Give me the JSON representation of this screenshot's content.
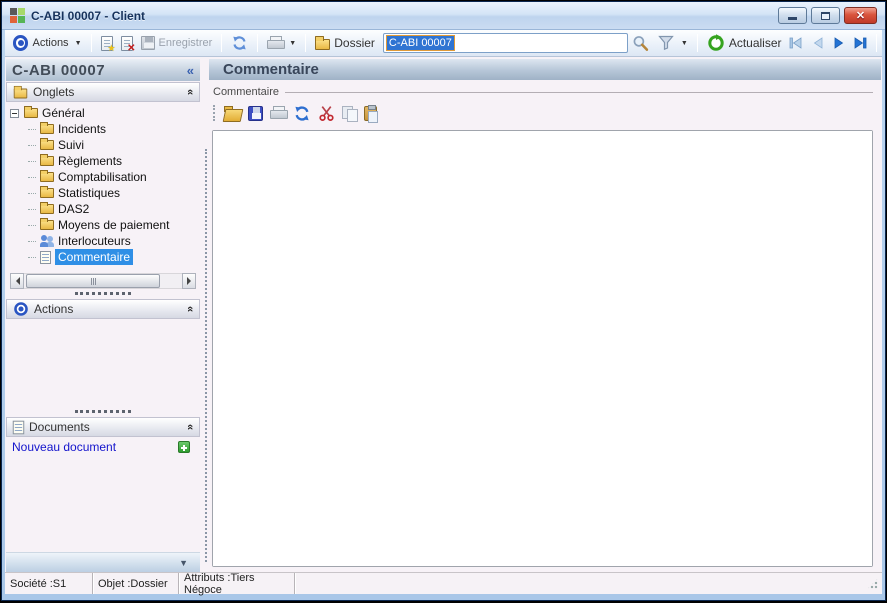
{
  "window": {
    "title": "C-ABI 00007 -  Client"
  },
  "toolbar": {
    "actions_label": "Actions",
    "enregistrer_label": "Enregistrer",
    "dossier_label": "Dossier",
    "search_value": "C-ABI 00007",
    "actualiser_label": "Actualiser"
  },
  "sidebar": {
    "title": "C-ABI 00007",
    "onglets_label": "Onglets",
    "actions_label": "Actions",
    "documents_label": "Documents",
    "new_document_label": "Nouveau document",
    "tree": {
      "root": "Général",
      "items": [
        "Incidents",
        "Suivi",
        "Règlements",
        "Comptabilisation",
        "Statistiques",
        "DAS2",
        "Moyens de paiement",
        "Interlocuteurs",
        "Commentaire"
      ]
    }
  },
  "main": {
    "header": "Commentaire",
    "group_label": "Commentaire",
    "editor_value": ""
  },
  "statusbar": {
    "societe": "Société :S1",
    "objet": "Objet :Dossier",
    "attributs": "Attributs :Tiers Négoce"
  },
  "icons": {
    "caret_down": "▼",
    "collapse_left": "«",
    "collapse_up": "«",
    "chevron_down": "▼",
    "close_x": "✕"
  },
  "colors": {
    "selection_blue": "#2f8fe6",
    "titlebar_blue": "#bed4ee",
    "close_red": "#c03a28",
    "link_blue": "#1414cc"
  }
}
